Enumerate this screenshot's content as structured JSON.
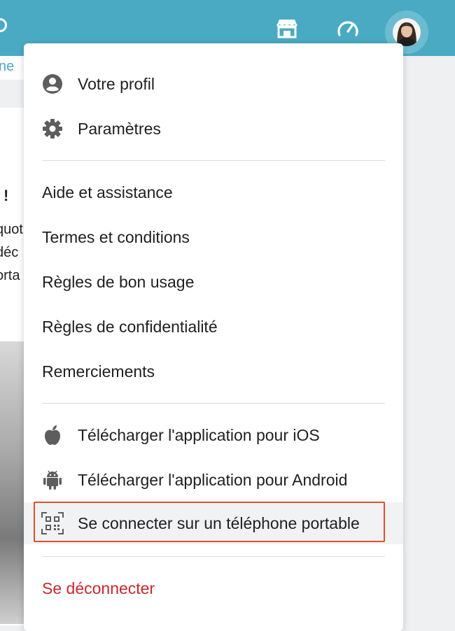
{
  "topbar": {
    "icons": [
      "storefront-icon",
      "speedometer-icon"
    ],
    "avatar": "user-avatar"
  },
  "background": {
    "tab_fragment": "ne",
    "text_fragments": [
      "!",
      "quot",
      "déc",
      "orta"
    ]
  },
  "menu": {
    "group1": [
      {
        "label": "Votre profil",
        "icon": "user-circle-icon"
      },
      {
        "label": "Paramètres",
        "icon": "gear-icon"
      }
    ],
    "group2": [
      {
        "label": "Aide et assistance"
      },
      {
        "label": "Termes et conditions"
      },
      {
        "label": "Règles de bon usage"
      },
      {
        "label": "Règles de confidentialité"
      },
      {
        "label": "Remerciements"
      }
    ],
    "group3": [
      {
        "label": "Télécharger l'application pour iOS",
        "icon": "apple-icon"
      },
      {
        "label": "Télécharger l'application pour Android",
        "icon": "android-icon"
      },
      {
        "label": "Se connecter sur un téléphone portable",
        "icon": "qr-code-icon"
      }
    ],
    "logout": {
      "label": "Se déconnecter"
    }
  },
  "colors": {
    "topbar": "#4aaac4",
    "logout": "#c6282d",
    "focus": "#e0502d"
  }
}
